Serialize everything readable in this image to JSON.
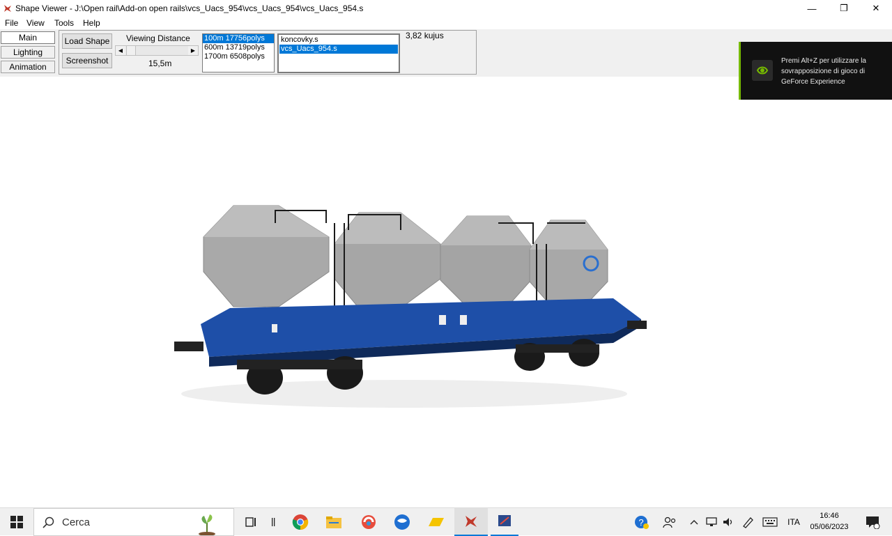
{
  "window": {
    "title": "Shape Viewer - J:\\Open rail\\Add-on open rails\\vcs_Uacs_954\\vcs_Uacs_954\\vcs_Uacs_954.s",
    "minimize": "—",
    "maximize": "❐",
    "close": "✕"
  },
  "menu": {
    "file": "File",
    "view": "View",
    "tools": "Tools",
    "help": "Help"
  },
  "tabs": {
    "main": "Main",
    "lighting": "Lighting",
    "animation": "Animation"
  },
  "toolbar": {
    "load_shape": "Load Shape",
    "screenshot": "Screenshot",
    "viewing_distance_label": "Viewing Distance",
    "viewing_distance_value": "15,5m",
    "objects_count": "3,82 kujus"
  },
  "lod_list": [
    "100m 17756polys",
    "600m 13719polys",
    "1700m 6508polys"
  ],
  "file_list": [
    "koncovky.s",
    "vcs_Uacs_954.s"
  ],
  "nvidia_overlay": {
    "text": "Premi Alt+Z per utilizzare la sovrapposizione di gioco di GeForce Experience"
  },
  "taskbar": {
    "search_placeholder": "Cerca",
    "language": "ITA",
    "time": "16:46",
    "date": "05/06/2023"
  },
  "colors": {
    "wagon_blue": "#1e4fa8",
    "hopper_gray": "#a8a8a8",
    "accent": "#0078d7"
  }
}
